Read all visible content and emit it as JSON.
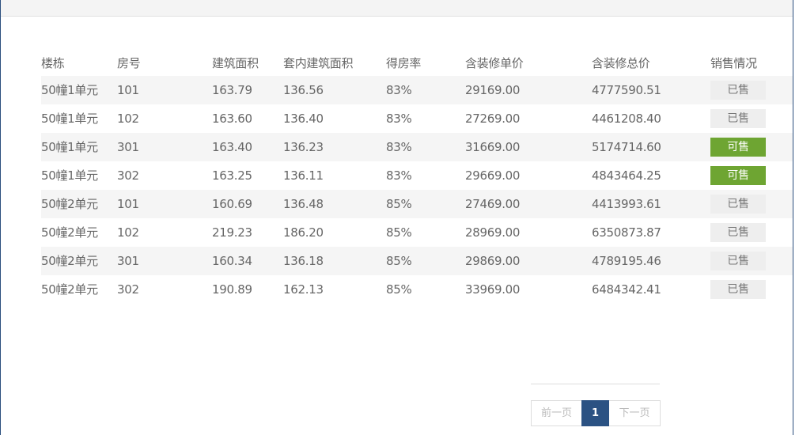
{
  "table": {
    "columns": [
      "楼栋",
      "房号",
      "建筑面积",
      "套内建筑面积",
      "得房率",
      "含装修单价",
      "含装修总价",
      "销售情况"
    ],
    "rows": [
      {
        "building": "50幢1单元",
        "room": "101",
        "area": "163.79",
        "inner_area": "136.56",
        "ratio": "83%",
        "unit_price": "29169.00",
        "total_price": "4777590.51",
        "status": "已售",
        "available": false
      },
      {
        "building": "50幢1单元",
        "room": "102",
        "area": "163.60",
        "inner_area": "136.40",
        "ratio": "83%",
        "unit_price": "27269.00",
        "total_price": "4461208.40",
        "status": "已售",
        "available": false
      },
      {
        "building": "50幢1单元",
        "room": "301",
        "area": "163.40",
        "inner_area": "136.23",
        "ratio": "83%",
        "unit_price": "31669.00",
        "total_price": "5174714.60",
        "status": "可售",
        "available": true
      },
      {
        "building": "50幢1单元",
        "room": "302",
        "area": "163.25",
        "inner_area": "136.11",
        "ratio": "83%",
        "unit_price": "29669.00",
        "total_price": "4843464.25",
        "status": "可售",
        "available": true
      },
      {
        "building": "50幢2单元",
        "room": "101",
        "area": "160.69",
        "inner_area": "136.48",
        "ratio": "85%",
        "unit_price": "27469.00",
        "total_price": "4413993.61",
        "status": "已售",
        "available": false
      },
      {
        "building": "50幢2单元",
        "room": "102",
        "area": "219.23",
        "inner_area": "186.20",
        "ratio": "85%",
        "unit_price": "28969.00",
        "total_price": "6350873.87",
        "status": "已售",
        "available": false
      },
      {
        "building": "50幢2单元",
        "room": "301",
        "area": "160.34",
        "inner_area": "136.18",
        "ratio": "85%",
        "unit_price": "29869.00",
        "total_price": "4789195.46",
        "status": "已售",
        "available": false
      },
      {
        "building": "50幢2单元",
        "room": "302",
        "area": "190.89",
        "inner_area": "162.13",
        "ratio": "85%",
        "unit_price": "33969.00",
        "total_price": "6484342.41",
        "status": "已售",
        "available": false
      }
    ]
  },
  "pagination": {
    "prev_label": "前一页",
    "current_page": "1",
    "next_label": "下一页"
  },
  "colors": {
    "available_badge": "#6ea532",
    "sold_badge": "#eeeeee",
    "current_page_bg": "#2b5283",
    "frame_border": "#2b4f7e"
  }
}
